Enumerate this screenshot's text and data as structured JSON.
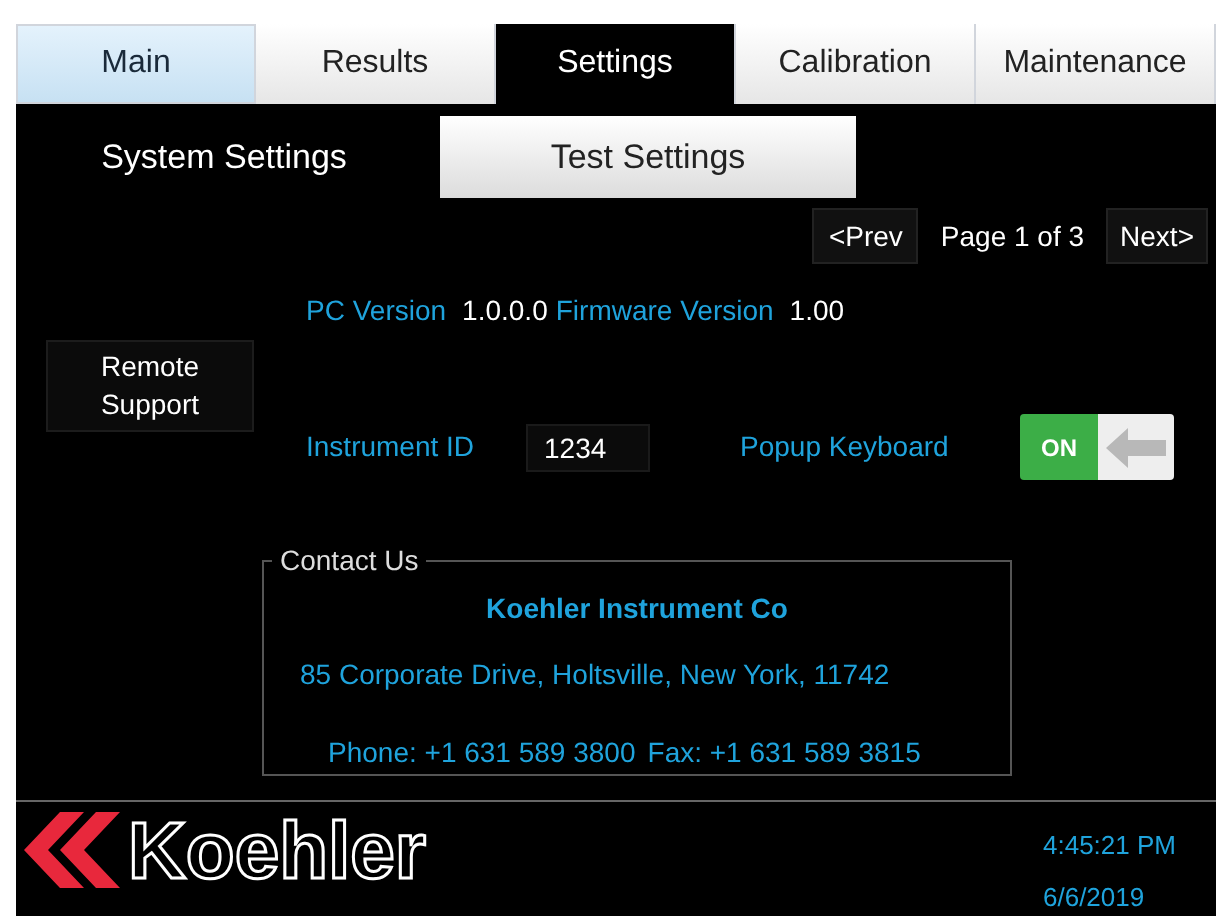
{
  "tabs": [
    {
      "label": "Main",
      "selected": false,
      "focused": true
    },
    {
      "label": "Results",
      "selected": false,
      "focused": false
    },
    {
      "label": "Settings",
      "selected": true,
      "focused": false
    },
    {
      "label": "Calibration",
      "selected": false,
      "focused": false
    },
    {
      "label": "Maintenance",
      "selected": false,
      "focused": false
    }
  ],
  "sub_tabs": [
    {
      "label": "System Settings",
      "selected": true
    },
    {
      "label": "Test Settings",
      "selected": false
    }
  ],
  "pager": {
    "prev": "<Prev",
    "page": "Page 1 of 3",
    "next": "Next>"
  },
  "remote_support": "Remote Support",
  "versions": [
    {
      "label": "PC Version",
      "value": "1.0.0.0"
    },
    {
      "label": "Firmware Version",
      "value": "1.00"
    }
  ],
  "instrument_id": {
    "label": "Instrument ID",
    "value": "1234"
  },
  "popup_keyboard": {
    "label": "Popup Keyboard",
    "on": true,
    "on_text": "ON"
  },
  "contact": {
    "legend": "Contact Us",
    "company": "Koehler Instrument Co",
    "address": "85 Corporate Drive, Holtsville, New York, 11742",
    "phone": "Phone: +1 631 589 3800",
    "fax": "Fax: +1 631 589 3815"
  },
  "footer": {
    "logo": "Koehler",
    "time": "4:45:21 PM",
    "date": "6/6/2019"
  }
}
